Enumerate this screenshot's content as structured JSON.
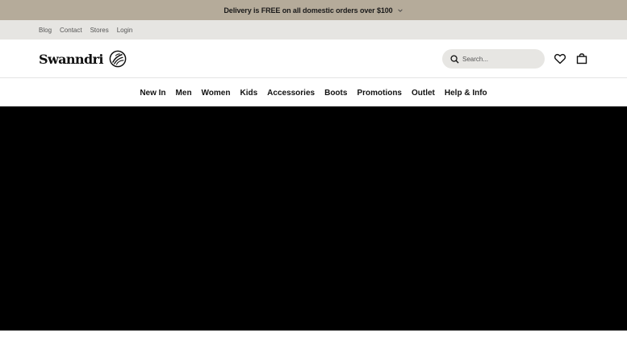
{
  "promo": {
    "text": "Delivery is FREE on all domestic orders over $100",
    "icon": "chevron-down-icon"
  },
  "utility": {
    "links": [
      {
        "label": "Blog"
      },
      {
        "label": "Contact"
      },
      {
        "label": "Stores"
      },
      {
        "label": "Login"
      }
    ]
  },
  "header": {
    "logo_text": "Swanndri",
    "logo_icon": "swanndri-bird-emblem-icon",
    "search_placeholder": "Search...",
    "icons": [
      "search-icon",
      "heart-icon",
      "bag-icon"
    ]
  },
  "nav": {
    "items": [
      {
        "label": "New In"
      },
      {
        "label": "Men"
      },
      {
        "label": "Women"
      },
      {
        "label": "Kids"
      },
      {
        "label": "Accessories"
      },
      {
        "label": "Boots"
      },
      {
        "label": "Promotions"
      },
      {
        "label": "Outlet"
      },
      {
        "label": "Help & Info"
      }
    ]
  },
  "colors": {
    "promo_bg": "#b5ab9a",
    "utility_bg": "#e6e5e2",
    "search_bg": "#e7e6e3",
    "hero_bg": "#000000"
  }
}
